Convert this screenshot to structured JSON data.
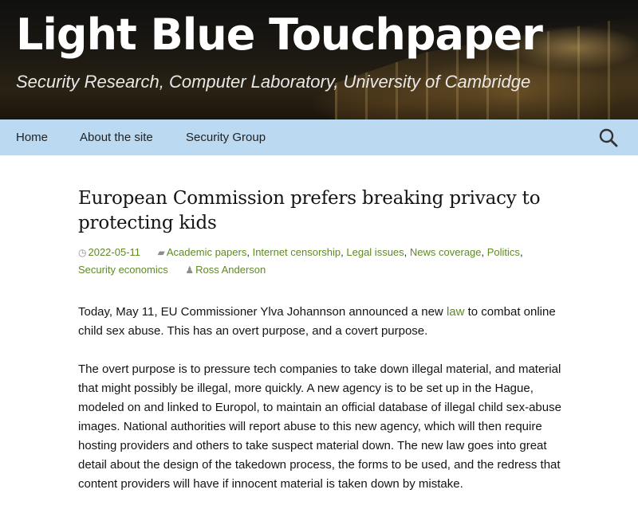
{
  "header": {
    "site_title": "Light Blue Touchpaper",
    "site_description": "Security Research, Computer Laboratory, University of Cambridge"
  },
  "nav": {
    "items": [
      {
        "label": "Home"
      },
      {
        "label": "About the site"
      },
      {
        "label": "Security Group"
      }
    ],
    "search_icon": "search-icon",
    "background_color": "#bcd9f2"
  },
  "post": {
    "title": "European Commission prefers breaking privacy to protecting kids",
    "date": "2022-05-11",
    "categories": [
      "Academic papers",
      "Internet censorship",
      "Legal issues",
      "News coverage",
      "Politics",
      "Security economics"
    ],
    "author": "Ross Anderson",
    "paragraph1_before_link": "Today, May 11, EU Commissioner Ylva Johannson announced a new ",
    "paragraph1_link": "law",
    "paragraph1_after_link": " to combat online child sex abuse. This has an overt purpose, and a covert purpose.",
    "paragraph2": "The overt purpose is to pressure tech companies to take down illegal material, and material that might possibly be illegal, more quickly. A new agency is to be set up in the Hague, modeled on and linked to Europol, to maintain an official database of illegal child sex-abuse images. National authorities will report abuse to this new agency, which will then require hosting providers and others to take suspect material down. The new law goes into great detail about the design of the takedown process, the forms to be used, and the redress that content providers will have if innocent material is taken down by mistake."
  },
  "colors": {
    "link": "#5f8a24",
    "meta_icon": "#8c8c8c"
  }
}
